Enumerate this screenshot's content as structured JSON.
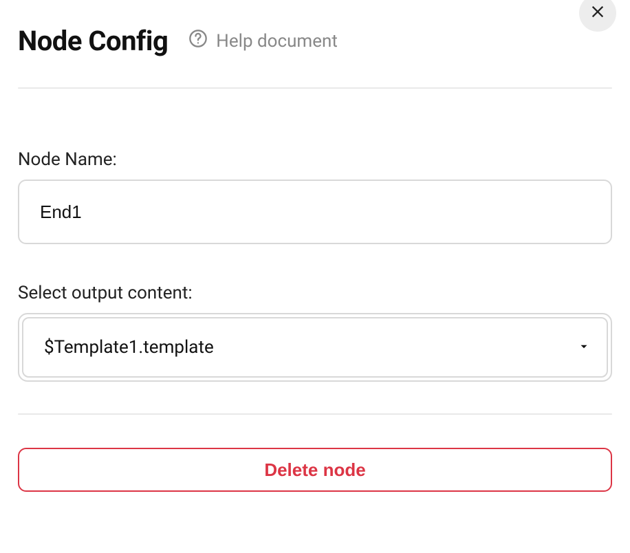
{
  "header": {
    "title": "Node Config",
    "help_label": "Help document"
  },
  "form": {
    "node_name_label": "Node Name:",
    "node_name_value": "End1",
    "select_label": "Select output content:",
    "select_value": "$Template1.template"
  },
  "actions": {
    "delete_label": "Delete node"
  }
}
